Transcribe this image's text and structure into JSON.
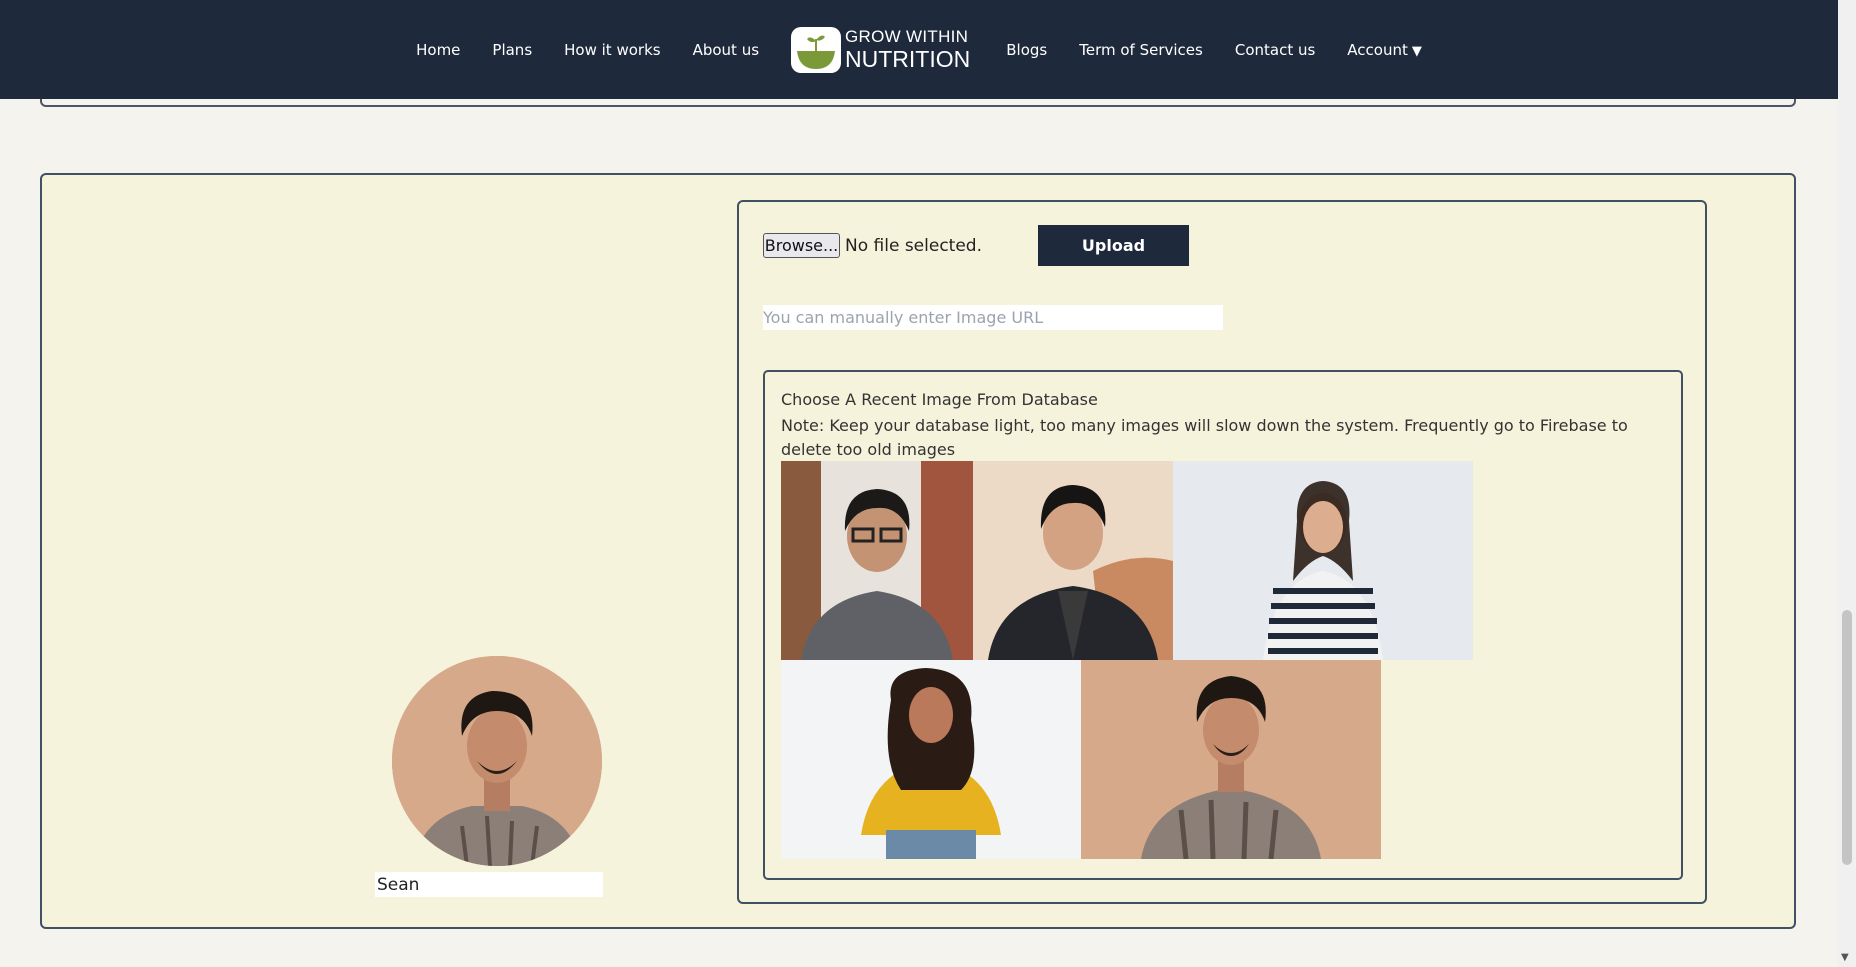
{
  "nav": {
    "left_links": [
      "Home",
      "Plans",
      "How it works",
      "About us"
    ],
    "logo": {
      "line1": "GROW WITHIN",
      "line2": "NUTRITION"
    },
    "right_links": [
      "Blogs",
      "Term of Services",
      "Contact us"
    ],
    "account_label": "Account",
    "account_caret": "▼"
  },
  "profile": {
    "name_value": "Sean"
  },
  "uploader": {
    "browse_label": "Browse...",
    "file_status": "No file selected.",
    "upload_label": "Upload",
    "url_placeholder": "You can manually enter Image URL"
  },
  "database": {
    "title": "Choose A Recent Image From Database",
    "note": "Note: Keep your database light, too many images will slow down the system. Frequently go to Firebase to delete too old images"
  },
  "colors": {
    "navbar": "#1e293b",
    "card_bg": "#f6f3dc",
    "border": "#3f5163",
    "page_bg": "#f5f3ee"
  }
}
